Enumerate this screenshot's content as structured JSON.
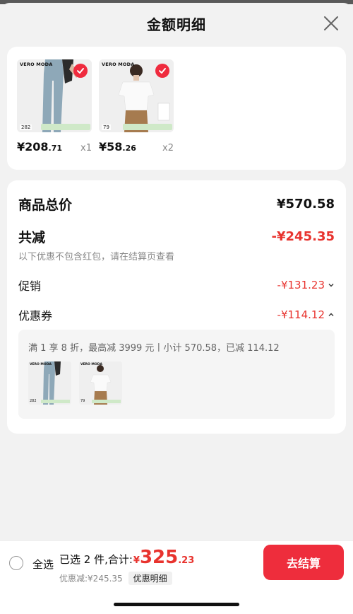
{
  "header": {
    "title": "金额明细"
  },
  "products": [
    {
      "brand": "VERO MODA",
      "code": "282",
      "price_int": "¥208",
      "price_dec": ".71",
      "qty": "x1"
    },
    {
      "brand": "VERO MODA",
      "code": "79",
      "price_int": "¥58",
      "price_dec": ".26",
      "qty": "x2"
    }
  ],
  "detail": {
    "total_label": "商品总价",
    "total_value": "¥570.58",
    "reduce_label": "共减",
    "reduce_value": "-¥245.35",
    "note": "以下优惠不包含红包，请在结算页查看",
    "promo_label": "促销",
    "promo_value": "-¥131.23",
    "coupon_label": "优惠券",
    "coupon_value": "-¥114.12",
    "coupon_desc": "满 1 享 8 折，最高减 3999 元丨小计 570.58，已减 114.12"
  },
  "footer": {
    "select_all": "全选",
    "summary_label": "已选 2 件,合计:",
    "currency": "¥",
    "total_int": "325",
    "total_dec": ".23",
    "discount": "优惠减:¥245.35",
    "detail_chip": "优惠明细",
    "checkout": "去结算"
  },
  "colors": {
    "accent": "#ee2d3c",
    "price_red": "#e8332e",
    "check_red": "#ef2b3e"
  }
}
